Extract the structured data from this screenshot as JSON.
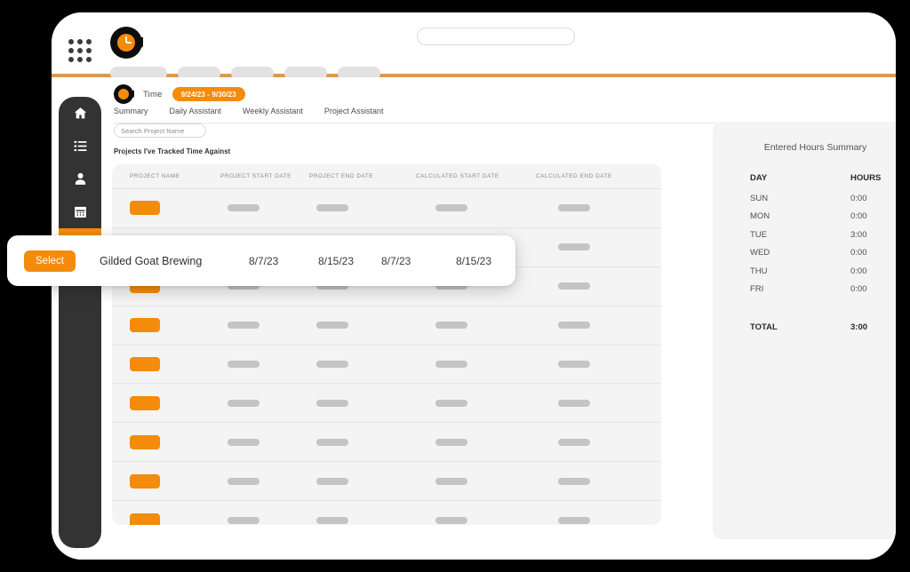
{
  "topbar": {
    "app_launcher_icon": "grid-dots-icon",
    "logo_icon": "clock-c-logo",
    "nav_pill_widths": [
      64,
      48,
      48,
      48,
      48
    ],
    "search_placeholder": ""
  },
  "sidebar": {
    "items": [
      {
        "name": "home",
        "icon": "home-icon",
        "active": false
      },
      {
        "name": "list",
        "icon": "list-icon",
        "active": false
      },
      {
        "name": "people",
        "icon": "person-icon",
        "active": false
      },
      {
        "name": "calendar",
        "icon": "calendar-icon",
        "active": false
      },
      {
        "name": "time",
        "icon": "clock-icon",
        "active": true
      }
    ]
  },
  "page": {
    "section_title": "Time",
    "date_range": "9/24/23 - 9/30/23",
    "tabs": [
      {
        "label": "Summary",
        "active": true
      },
      {
        "label": "Daily Assistant",
        "active": false
      },
      {
        "label": "Weekly Assistant",
        "active": false
      },
      {
        "label": "Project Assistant",
        "active": false
      }
    ],
    "search_placeholder": "Search Project Name",
    "table_caption": "Projects I've Tracked Time Against"
  },
  "table": {
    "columns": [
      "PROJECT NAME",
      "PROJECT START DATE",
      "PROJECT END DATE",
      "CALCULATED START DATE",
      "CALCULATED END DATE"
    ],
    "skeleton_row_count": 9
  },
  "selected_row": {
    "select_label": "Select",
    "project_name": "Gilded Goat Brewing",
    "project_start_date": "8/7/23",
    "project_end_date": "8/15/23",
    "calculated_start_date": "8/7/23",
    "calculated_end_date": "8/15/23"
  },
  "summary": {
    "title": "Entered Hours Summary",
    "header": {
      "day": "DAY",
      "hours": "HOURS"
    },
    "rows": [
      {
        "day": "SUN",
        "hours": "0:00"
      },
      {
        "day": "MON",
        "hours": "0:00"
      },
      {
        "day": "TUE",
        "hours": "3:00"
      },
      {
        "day": "WED",
        "hours": "0:00"
      },
      {
        "day": "THU",
        "hours": "0:00"
      },
      {
        "day": "FRI",
        "hours": "0:00"
      }
    ],
    "total": {
      "day": "TOTAL",
      "hours": "3:00"
    }
  },
  "colors": {
    "accent": "#f58b0a",
    "rail": "#333333",
    "panel": "#f4f4f4",
    "divider": "#d79a4e",
    "page_background": "#000000"
  }
}
